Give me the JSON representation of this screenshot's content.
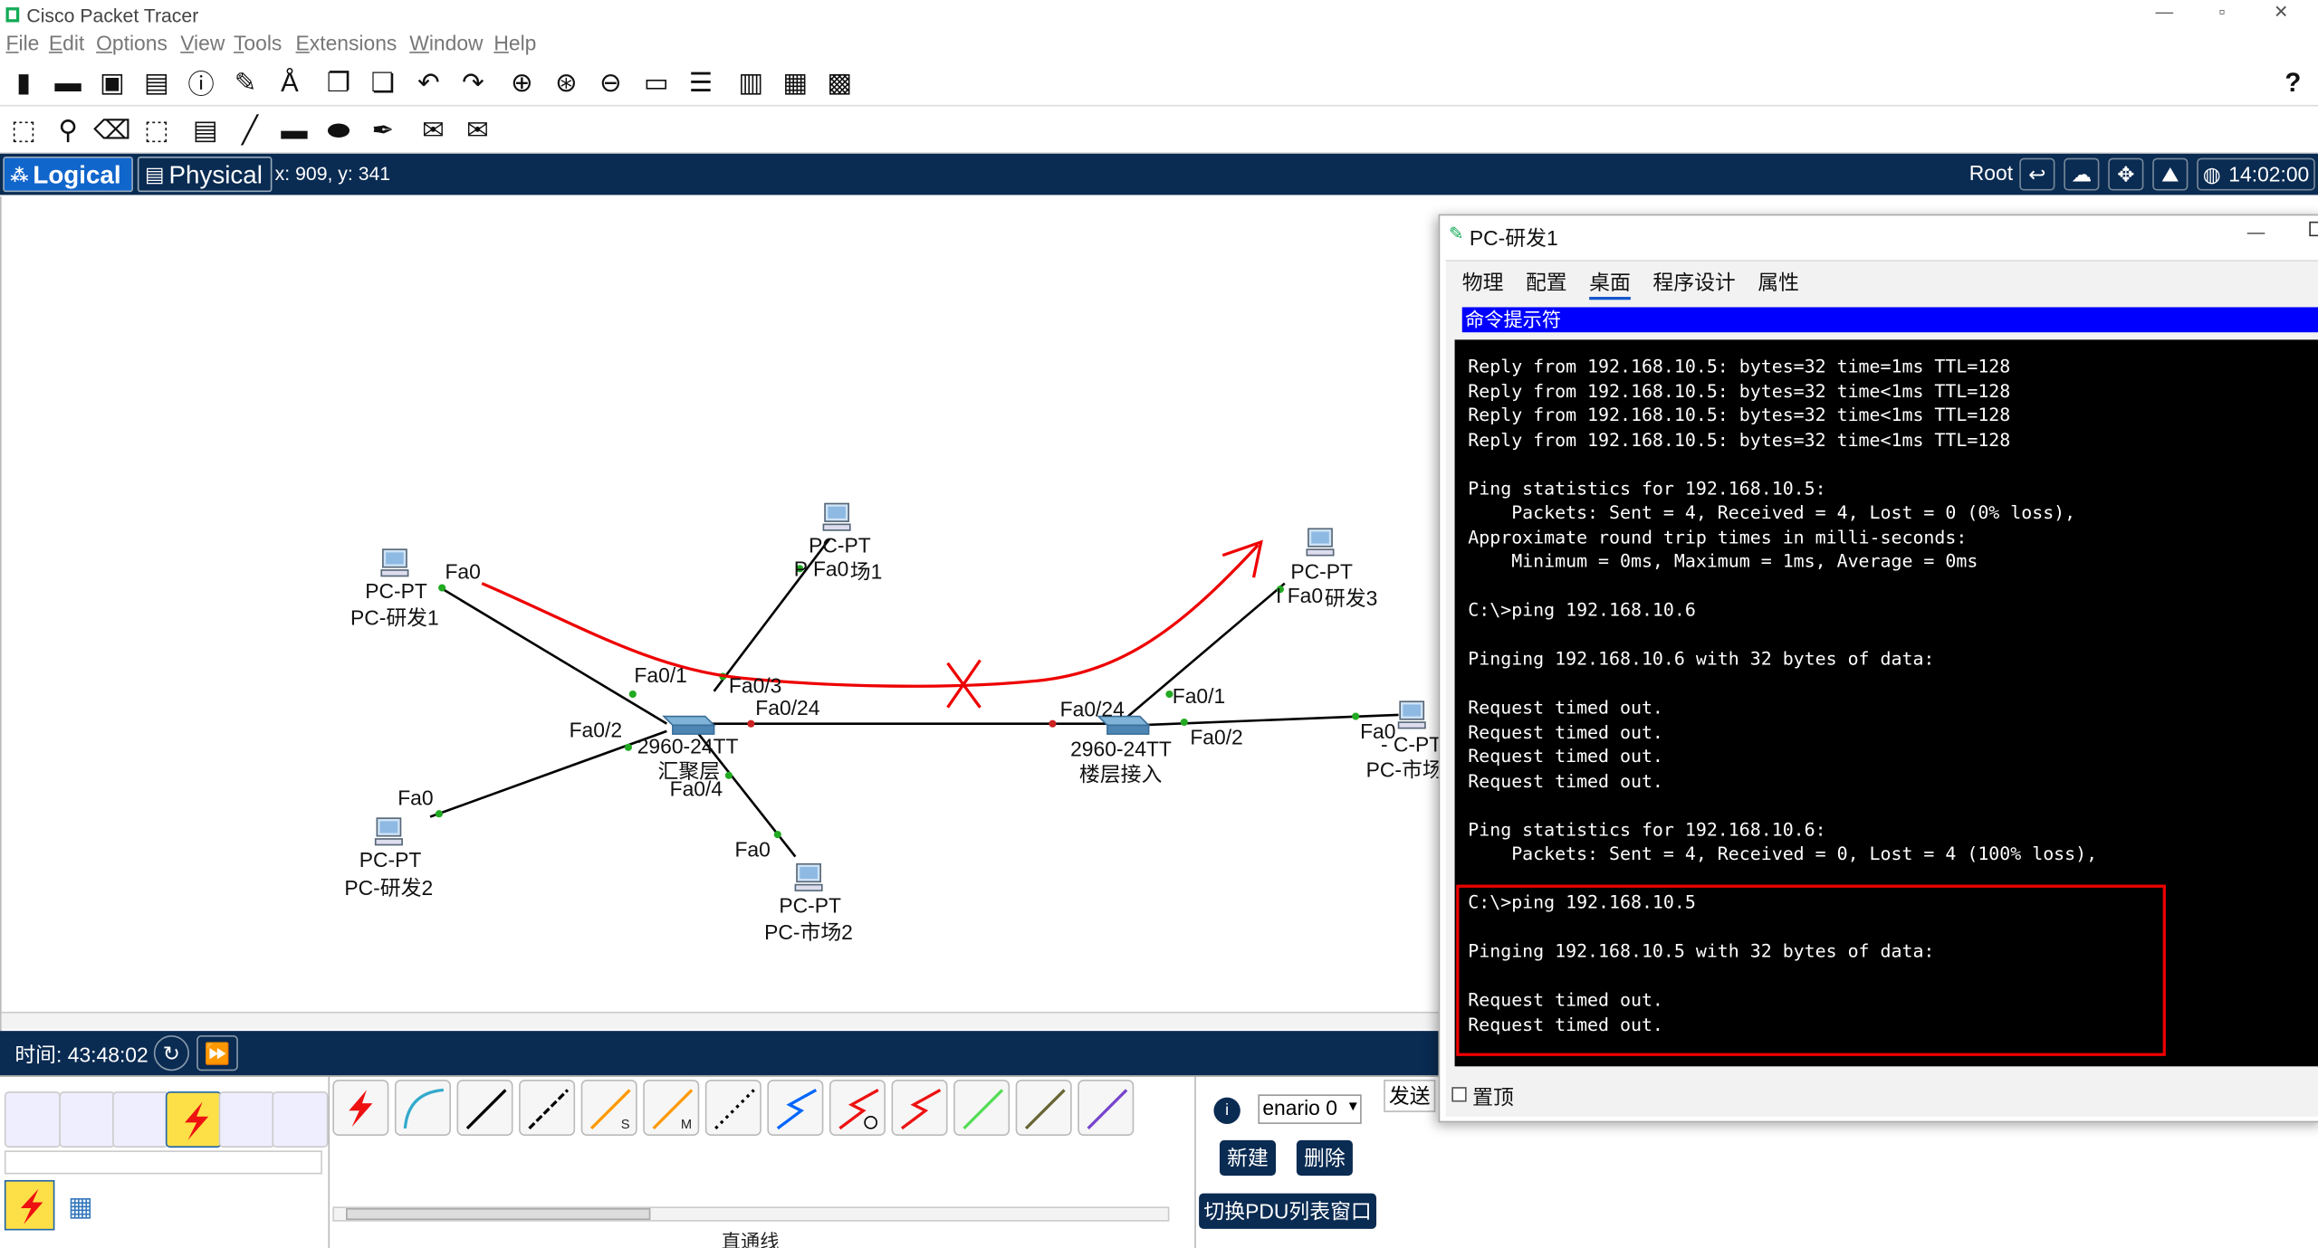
{
  "app": {
    "title": "Cisco Packet Tracer",
    "window_controls": {
      "minimize": "—",
      "maximize": "▫",
      "close": "✕"
    }
  },
  "menu": [
    "File",
    "Edit",
    "Options",
    "View",
    "Tools",
    "Extensions",
    "Window",
    "Help"
  ],
  "toolbar": {
    "help": "?"
  },
  "nav": {
    "logical_tab": "Logical",
    "physical_tab": "Physical",
    "coords": "x: 909, y: 341",
    "root": "Root",
    "clock": "14:02:00"
  },
  "topology": {
    "devices": [
      {
        "type": "PC-PT",
        "name": "PC-研发1"
      },
      {
        "type": "PC-PT",
        "name": "场1"
      },
      {
        "type": "PC-PT",
        "name": "研发3"
      },
      {
        "type": "PC-PT",
        "name": "PC-市场"
      },
      {
        "type": "PC-PT",
        "name": "PC-研发2"
      },
      {
        "type": "PC-PT",
        "name": "PC-市场2"
      }
    ],
    "switches": [
      {
        "model": "2960-24TT",
        "name": "汇聚层"
      },
      {
        "model": "2960-24TT",
        "name": "楼层接入"
      }
    ],
    "ports": {
      "fa0": "Fa0",
      "fa01": "Fa0/1",
      "fa02": "Fa0/2",
      "fa03": "Fa0/3",
      "fa04": "Fa0/4",
      "fa024": "Fa0/24",
      "p_fa0": "P Fa0",
      "i_fa0": "I Fa0",
      "dash_pt": "- C-PT"
    }
  },
  "timebar": {
    "time_label": "时间: 43:48:02"
  },
  "bottom": {
    "scenario": "enario 0",
    "send": "发送",
    "new": "新建",
    "delete": "删除",
    "toggle_pdu": "切换PDU列表窗口",
    "cable_name": "直通线"
  },
  "pc_window": {
    "title": "PC-研发1",
    "minimize": "—",
    "tabs": [
      "物理",
      "配置",
      "桌面",
      "程序设计",
      "属性"
    ],
    "active_tab": "桌面",
    "cmd_title": "命令提示符",
    "terminal": [
      "Reply from 192.168.10.5: bytes=32 time=1ms TTL=128",
      "Reply from 192.168.10.5: bytes=32 time<1ms TTL=128",
      "Reply from 192.168.10.5: bytes=32 time<1ms TTL=128",
      "Reply from 192.168.10.5: bytes=32 time<1ms TTL=128",
      "",
      "Ping statistics for 192.168.10.5:",
      "    Packets: Sent = 4, Received = 4, Lost = 0 (0% loss),",
      "Approximate round trip times in milli-seconds:",
      "    Minimum = 0ms, Maximum = 1ms, Average = 0ms",
      "",
      "C:\\>ping 192.168.10.6",
      "",
      "Pinging 192.168.10.6 with 32 bytes of data:",
      "",
      "Request timed out.",
      "Request timed out.",
      "Request timed out.",
      "Request timed out.",
      "",
      "Ping statistics for 192.168.10.6:",
      "    Packets: Sent = 4, Received = 0, Lost = 4 (100% loss),",
      "",
      "C:\\>ping 192.168.10.5",
      "",
      "Pinging 192.168.10.5 with 32 bytes of data:",
      "",
      "Request timed out.",
      "Request timed out."
    ],
    "always_on_top": "置顶"
  }
}
